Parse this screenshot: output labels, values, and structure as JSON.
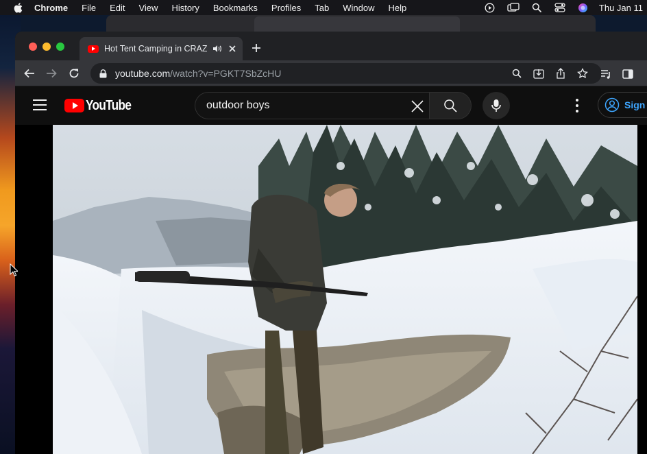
{
  "menubar": {
    "app_name": "Chrome",
    "items": [
      "File",
      "Edit",
      "View",
      "History",
      "Bookmarks",
      "Profiles",
      "Tab",
      "Window",
      "Help"
    ],
    "clock": "Thu Jan 11"
  },
  "browser": {
    "tab": {
      "title": "Hot Tent Camping in CRAZ",
      "favicon": "youtube-favicon",
      "audio_icon": "speaker-icon",
      "close_icon": "close-icon"
    },
    "new_tab_icon": "plus-icon",
    "address": {
      "host": "youtube.com",
      "path": "/watch?v=PGKT7SbZcHU"
    },
    "colors": {
      "tab_bar": "#202124",
      "toolbar": "#35363a",
      "omnibox": "#202124"
    }
  },
  "youtube": {
    "logo_text": "YouTube",
    "search": {
      "query": "outdoor boys",
      "placeholder": "Search"
    },
    "signin_label": "Sign in",
    "colors": {
      "brand_red": "#ff0000",
      "link_blue": "#3ea6ff",
      "background": "#0f0f0f"
    }
  }
}
